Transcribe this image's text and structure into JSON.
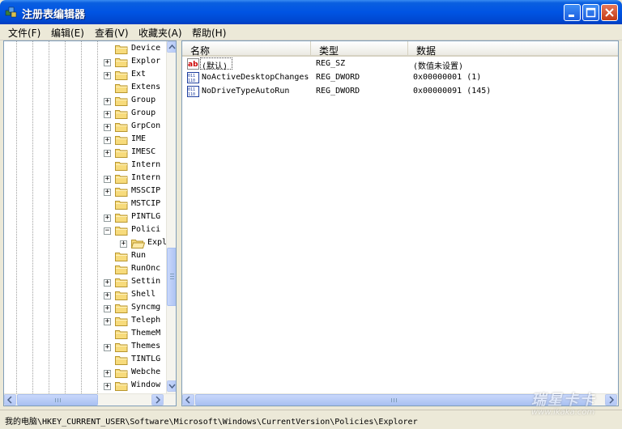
{
  "window": {
    "title": "注册表编辑器"
  },
  "menu": [
    "文件(F)",
    "编辑(E)",
    "查看(V)",
    "收藏夹(A)",
    "帮助(H)"
  ],
  "tree": {
    "items": [
      {
        "label": "Device",
        "expander": ""
      },
      {
        "label": "Explor",
        "expander": "+"
      },
      {
        "label": "Ext",
        "expander": "+"
      },
      {
        "label": "Extens",
        "expander": ""
      },
      {
        "label": "Group ",
        "expander": "+"
      },
      {
        "label": "Group ",
        "expander": "+"
      },
      {
        "label": "GrpCon",
        "expander": "+"
      },
      {
        "label": "IME",
        "expander": "+"
      },
      {
        "label": "IMESC",
        "expander": "+"
      },
      {
        "label": "Intern",
        "expander": ""
      },
      {
        "label": "Intern",
        "expander": "+"
      },
      {
        "label": "MSSCIP",
        "expander": "+"
      },
      {
        "label": "MSTCIP",
        "expander": ""
      },
      {
        "label": "PINTLG",
        "expander": "+"
      },
      {
        "label": "Polici",
        "expander": "−"
      },
      {
        "label": "Expl",
        "expander": "+",
        "child": true
      },
      {
        "label": "Run",
        "expander": ""
      },
      {
        "label": "RunOnc",
        "expander": ""
      },
      {
        "label": "Settin",
        "expander": "+"
      },
      {
        "label": "Shell ",
        "expander": "+"
      },
      {
        "label": "Syncmg",
        "expander": "+"
      },
      {
        "label": "Teleph",
        "expander": "+"
      },
      {
        "label": "ThemeM",
        "expander": ""
      },
      {
        "label": "Themes",
        "expander": "+"
      },
      {
        "label": "TINTLG",
        "expander": ""
      },
      {
        "label": "Webche",
        "expander": "+"
      },
      {
        "label": "Window",
        "expander": "+"
      }
    ]
  },
  "list": {
    "columns": [
      "名称",
      "类型",
      "数据"
    ],
    "rows": [
      {
        "icon": "string-value-icon",
        "name": "(默认)",
        "type": "REG_SZ",
        "data": "(数值未设置)"
      },
      {
        "icon": "dword-value-icon",
        "name": "NoActiveDesktopChanges",
        "type": "REG_DWORD",
        "data": "0x00000001 (1)"
      },
      {
        "icon": "dword-value-icon",
        "name": "NoDriveTypeAutoRun",
        "type": "REG_DWORD",
        "data": "0x00000091 (145)"
      }
    ]
  },
  "status": {
    "path": "我的电脑\\HKEY_CURRENT_USER\\Software\\Microsoft\\Windows\\CurrentVersion\\Policies\\Explorer"
  },
  "watermark": {
    "brand": "瑞星卡卡",
    "url": "www.ikaka.com"
  }
}
